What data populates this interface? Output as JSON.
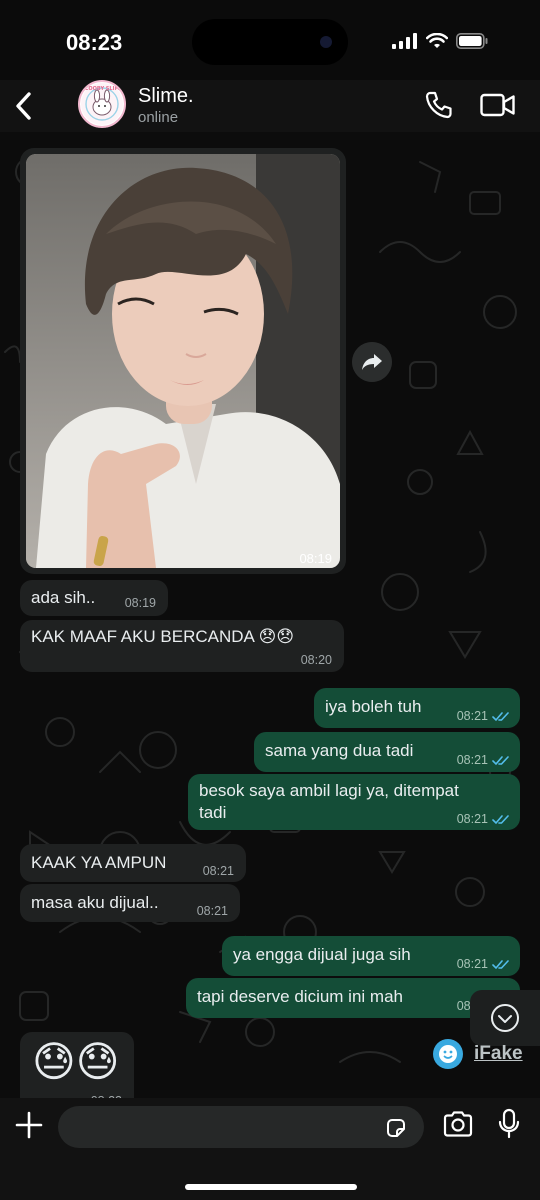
{
  "status_bar": {
    "time": "08:23"
  },
  "header": {
    "contact_name": "Slime.",
    "status": "online",
    "avatar_text": "SCOOBY SLIME"
  },
  "messages": [
    {
      "type": "image",
      "direction": "in",
      "time": "08:19"
    },
    {
      "type": "text",
      "direction": "in",
      "text": "ada sih..",
      "time": "08:19"
    },
    {
      "type": "text",
      "direction": "in",
      "text": "KAK MAAF AKU BERCANDA 😞😞",
      "time": "08:20"
    },
    {
      "type": "text",
      "direction": "out",
      "text": "iya boleh tuh",
      "time": "08:21"
    },
    {
      "type": "text",
      "direction": "out",
      "text": "sama yang dua tadi",
      "time": "08:21"
    },
    {
      "type": "text",
      "direction": "out",
      "text_line1": "besok saya ambil lagi ya, ditempat",
      "text_line2": "tadi",
      "time": "08:21"
    },
    {
      "type": "text",
      "direction": "in",
      "text": "KAAK YA AMPUN",
      "time": "08:21"
    },
    {
      "type": "text",
      "direction": "in",
      "text": "masa aku dijual..",
      "time": "08:21"
    },
    {
      "type": "text",
      "direction": "out",
      "text": "ya engga dijual juga sih",
      "time": "08:21"
    },
    {
      "type": "text",
      "direction": "out",
      "text": "tapi deserve dicium ini mah",
      "time": "08:21"
    },
    {
      "type": "emoji",
      "direction": "in",
      "text": "😓😓",
      "time": "08:22"
    }
  ],
  "watermark": {
    "text": "iFake"
  },
  "colors": {
    "incoming": "#1f2121",
    "outgoing": "#144d37",
    "read_ticks": "#53bdeb",
    "background": "#0c0c0c"
  }
}
